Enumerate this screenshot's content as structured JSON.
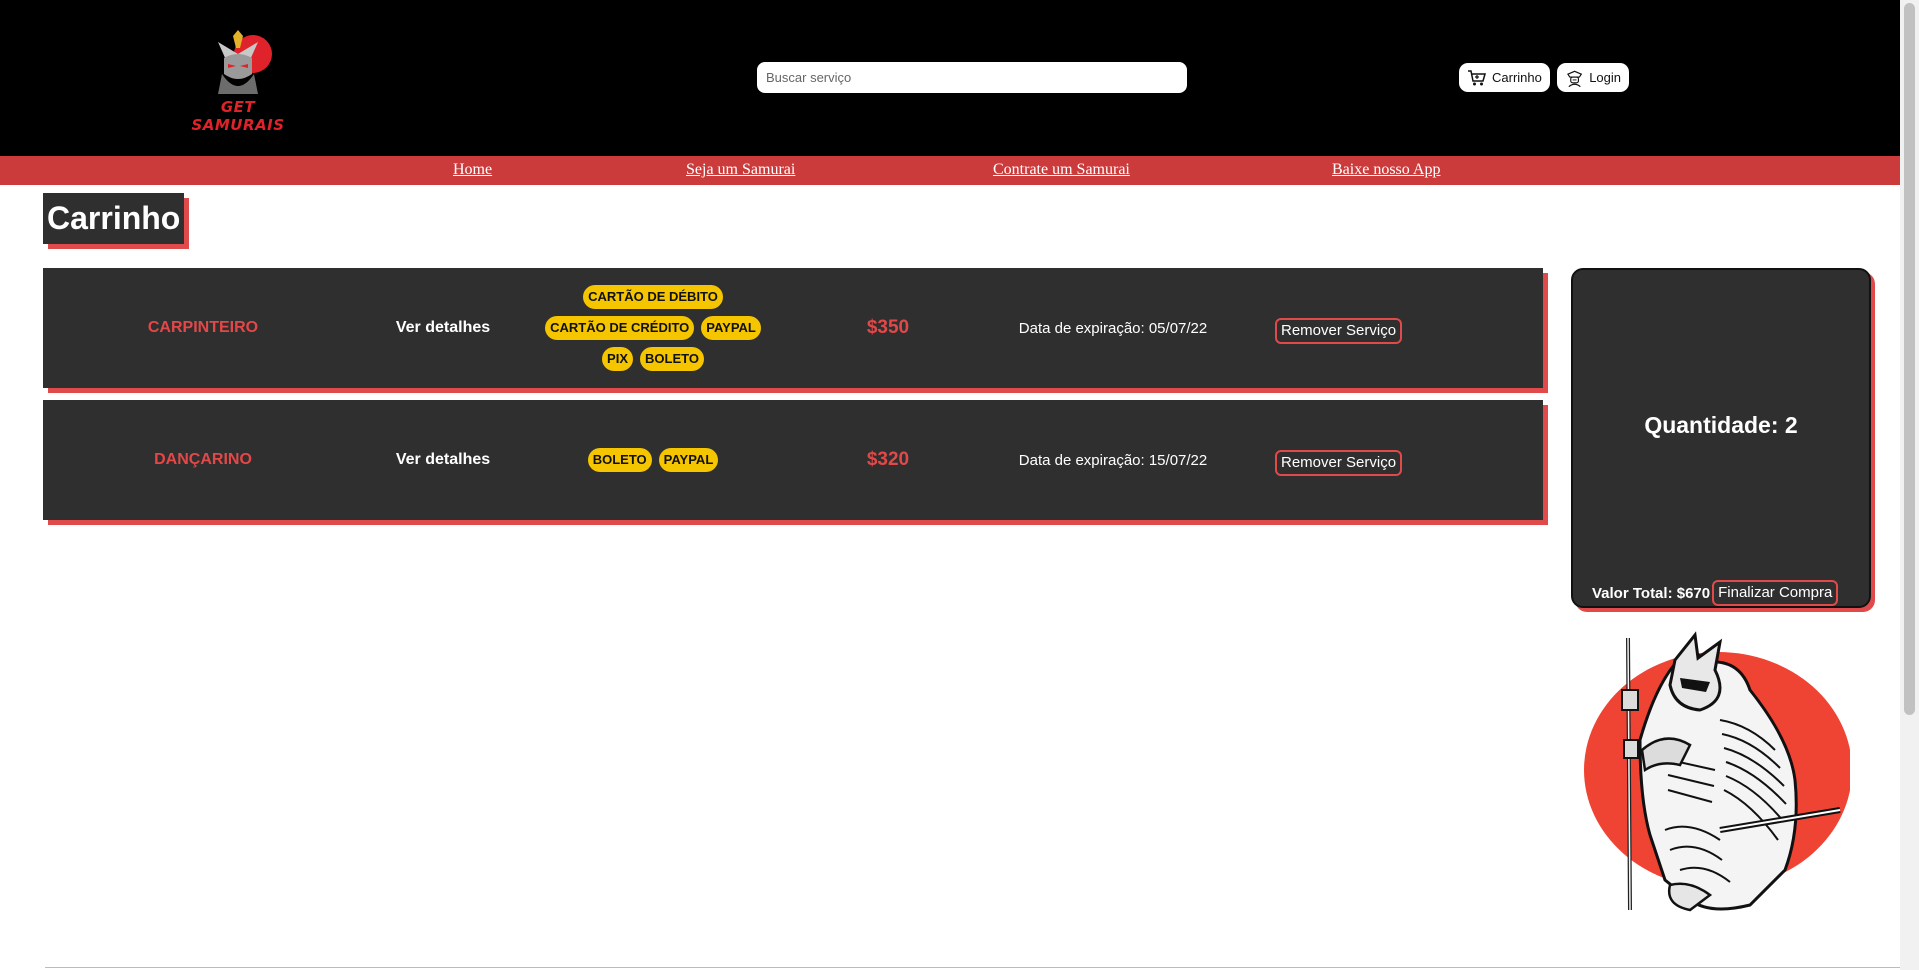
{
  "header": {
    "logo_text": "GET SAMURAIS",
    "search_placeholder": "Buscar serviço",
    "cart_label": "Carrinho",
    "login_label": "Login"
  },
  "nav": {
    "items": [
      "Home",
      "Seja um Samurai",
      "Contrate um Samurai",
      "Baixe nosso App"
    ]
  },
  "page": {
    "title": "Carrinho"
  },
  "cart": {
    "items": [
      {
        "service": "CARPINTEIRO",
        "details_label": "Ver detalhes",
        "payments": [
          "CARTÃO DE DÉBITO",
          "CARTÃO DE CRÉDITO",
          "PAYPAL",
          "PIX",
          "BOLETO"
        ],
        "price": "$350",
        "expiry": "Data de expiração: 05/07/22",
        "remove_label": "Remover Serviço"
      },
      {
        "service": "DANÇARINO",
        "details_label": "Ver detalhes",
        "payments": [
          "BOLETO",
          "PAYPAL"
        ],
        "price": "$320",
        "expiry": "Data de expiração: 15/07/22",
        "remove_label": "Remover Serviço"
      }
    ]
  },
  "summary": {
    "quantity": "Quantidade: 2",
    "total": "Valor Total: $670",
    "finish_label": "Finalizar Compra"
  },
  "colors": {
    "header_bg": "#000000",
    "nav_bg": "#cc3b3b",
    "card_bg": "#2f2f2f",
    "accent_red": "#e04a4a",
    "pill_yellow": "#f5c500"
  },
  "icons": [
    "samurai-logo-icon",
    "cart-icon",
    "samurai-avatar-icon",
    "samurai-illustration"
  ]
}
